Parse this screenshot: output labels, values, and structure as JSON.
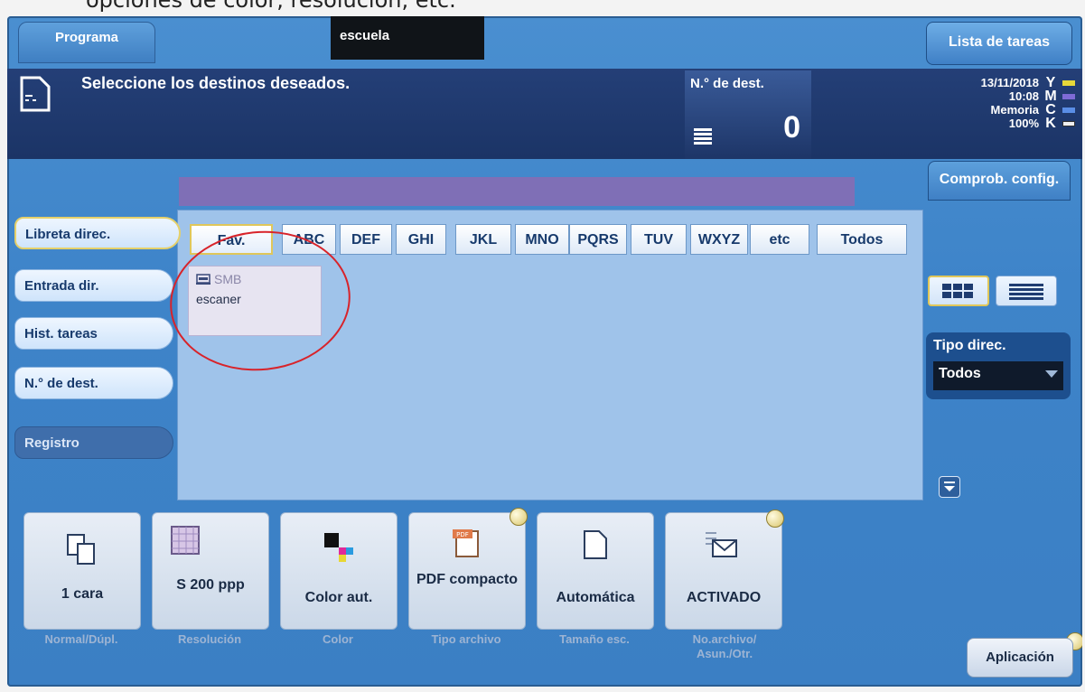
{
  "caption": "opciones de color, resolución, etc.",
  "header": {
    "program_tab": "Programa",
    "program_name": "escuela",
    "task_list_button": "Lista de tareas",
    "instruction": "Seleccione los destinos deseados.",
    "dest_count_label": "N.° de dest.",
    "dest_count": "0"
  },
  "status": {
    "date": "13/11/2018",
    "time": "10:08",
    "memory_label": "Memoria",
    "memory_value": "100%",
    "toner": [
      {
        "letter": "Y",
        "color": "#e6d83a"
      },
      {
        "letter": "M",
        "color": "#7e6bd6"
      },
      {
        "letter": "C",
        "color": "#5a8ee6"
      },
      {
        "letter": "K",
        "color": "#f0f0f0"
      }
    ]
  },
  "check_config_button": "Comprob. config.",
  "sidebar": {
    "items": [
      {
        "label": "Libreta direc.",
        "active": true
      },
      {
        "label": "Entrada dir."
      },
      {
        "label": "Hist. tareas"
      },
      {
        "label": "N.° de dest."
      }
    ],
    "registro": "Registro"
  },
  "filters": [
    "Fav.",
    "ABC",
    "DEF",
    "GHI",
    "JKL",
    "MNO",
    "PQRS",
    "TUV",
    "WXYZ",
    "etc",
    "Todos"
  ],
  "destinations": [
    {
      "type": "SMB",
      "name": "escaner"
    }
  ],
  "address_type": {
    "label": "Tipo direc.",
    "value": "Todos"
  },
  "functions": [
    {
      "value": "1 cara",
      "label": "Normal/Dúpl.",
      "icon": "duplex-icon"
    },
    {
      "value": "S 200 ppp",
      "label": "Resolución",
      "icon": "resolution-icon"
    },
    {
      "value": "Color aut.",
      "label": "Color",
      "icon": "color-icon"
    },
    {
      "value": "PDF compacto",
      "label": "Tipo archivo",
      "icon": "pdf-icon"
    },
    {
      "value": "Automática",
      "label": "Tamaño esc.",
      "icon": "page-size-icon"
    },
    {
      "value": "ACTIVADO",
      "label": "No.archivo/ Asun./Otr.",
      "icon": "mail-icon"
    }
  ],
  "application_button": "Aplicación",
  "colors": {
    "screen_blue": "#3e84c9",
    "header_navy": "#1b3466",
    "highlight_yellow": "#e0c75a",
    "annotation_red": "#d8232a",
    "purple_bar": "#7f6fb6"
  }
}
